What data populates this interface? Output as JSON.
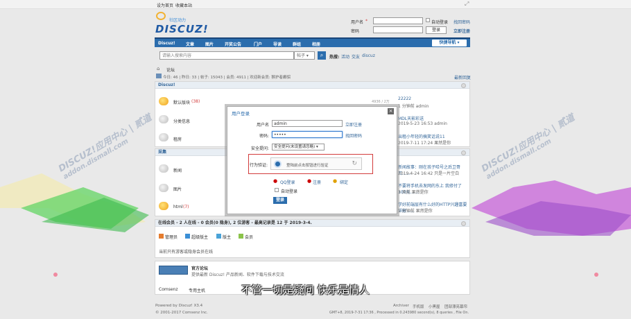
{
  "topbar": {
    "set_home": "设为首页",
    "bookmark": "收藏本站"
  },
  "logo": {
    "text": "DISCUZ!",
    "sub": "社区动力"
  },
  "login_bar": {
    "username_label": "用户名",
    "email_label": "密码",
    "auto_login": "自动登录",
    "find_password": "找回密码",
    "login_button": "登录",
    "register": "立即注册"
  },
  "nav": {
    "items": [
      "Discuz!",
      "文章",
      "图片",
      "开奖公告",
      "门户",
      "导读",
      "群组",
      "相册"
    ],
    "quick": "快捷导航"
  },
  "search": {
    "placeholder": "请输入搜索内容",
    "scope": "帖子",
    "hot_label": "热搜:",
    "hot": [
      "活动",
      "交友",
      "discuz"
    ]
  },
  "breadcrumb": {
    "forum": "论坛"
  },
  "stats": {
    "text": "今日: 46 | 昨日: 33 | 帖子: 15043 | 会员: 4911 | 欢迎新会员: 猴护者癫貂",
    "latest": "最新回复"
  },
  "section1": {
    "title": "Discuz!",
    "forums": [
      {
        "name": "默认版块",
        "count": "(38)",
        "right_count": "4936 / 2万",
        "last_title": "22222",
        "last_meta": "1 分钟前 admin"
      },
      {
        "name": "分类信息",
        "count": "",
        "right_count": "",
        "last_title": "MDL天影彩送",
        "last_meta": "2019-5-23 16:53 admin"
      },
      {
        "name": "租房",
        "count": "",
        "right_count": "",
        "last_title": "出租小年轻的搞笑话说11",
        "last_meta": "2019-7-11 17:24 果然是你"
      }
    ]
  },
  "section2": {
    "title": "采集",
    "forums": [
      {
        "name": "新闻",
        "count": "",
        "last_title": "新闻故事：刚在孩子哈号之后卫哥日……",
        "last_meta": "2019-4-24 16:42 只是一片空白"
      },
      {
        "name": "图片",
        "count": "",
        "last_title": "不要将手机去发网的东上 我修付了100元……",
        "last_meta": "3 天前 果然是你"
      },
      {
        "name": "html",
        "count": "(7)",
        "last_title": "学好前端层有什么好的HTTP兴趣富要详解……",
        "last_meta": "1 分钟前 果然是你"
      }
    ]
  },
  "online": {
    "title": "在线会员 - 2 人在线 - 0 会员(0 隐身), 2 位游客 - 最高记录是 12 于 2019-3-4.",
    "roles": [
      "管理员",
      "超级版主",
      "版主",
      "会员"
    ],
    "note": "当前只有游客或隐身会员在线"
  },
  "links": {
    "name": "官方论坛",
    "desc": "提供最新 Discuz! 产品新闻、软件下载与技术交流",
    "partners": [
      "Comsenz",
      "专用主机"
    ]
  },
  "footer": {
    "powered": "Powered by Discuz! X3.4",
    "copyright": "© 2001-2017 Comsenz Inc.",
    "links": [
      "Archiver",
      "手机版",
      "小黑屋",
      "团部漂亮幕帘"
    ],
    "time": "GMT+8, 2019-7-31 17:36 , Processed in 0.243980 second(s), 8 queries , File On."
  },
  "modal": {
    "title": "用户登录",
    "username_label": "用户名",
    "username_value": "admin",
    "register": "立即注册",
    "password_label": "密码:",
    "password_value": "•••••",
    "forgot": "找回密码",
    "question_label": "安全提问:",
    "question_value": "安全提问(未设置请忽略)",
    "verify_label": "行为验证:",
    "verify_text": "登陆前点击按钮进行验证",
    "providers": [
      "QQ登录",
      "注册",
      "绑定"
    ],
    "auto_login": "自动登录",
    "submit": "登录"
  },
  "watermark": {
    "text": "DISCUZ!应用中心 | 贰道",
    "url": "addon.dismall.com"
  },
  "subtitle": "不管一切是疑问 快乐是情人",
  "colors": {
    "nav": "#2b6dad",
    "link": "#336699",
    "highlight": "#d23b3b"
  }
}
